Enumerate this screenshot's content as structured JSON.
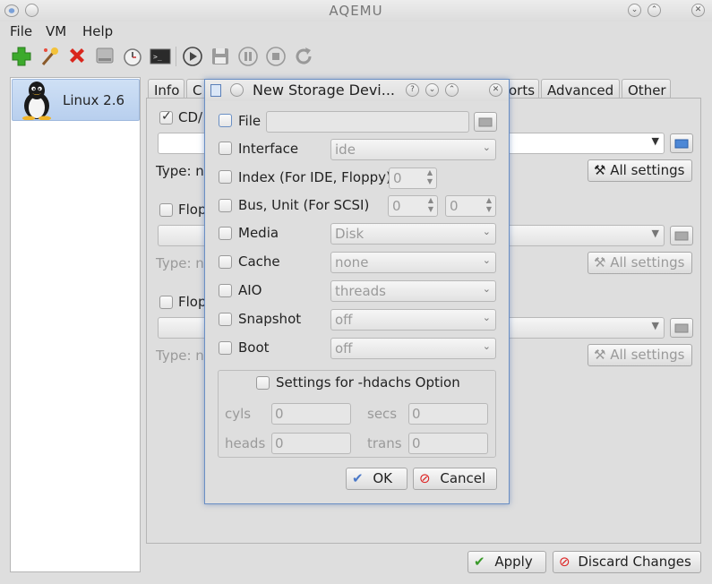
{
  "window": {
    "title": "AQEMU"
  },
  "menu": {
    "file": "File",
    "vm": "VM",
    "help": "Help"
  },
  "vm_list": [
    {
      "name": "Linux 2.6"
    }
  ],
  "tabs": {
    "info": "Info",
    "c": "C",
    "ports": "orts",
    "advanced": "Advanced",
    "other": "Other"
  },
  "background_panel": {
    "cdrom_label": "CD/",
    "floppy1_label": "Flop",
    "floppy2_label": "Flop",
    "type_label": "Type: n",
    "all_settings": "All settings"
  },
  "dialog": {
    "title": "New Storage Devi...",
    "rows": {
      "file": {
        "label": "File",
        "value": ""
      },
      "interface": {
        "label": "Interface",
        "value": "ide"
      },
      "index": {
        "label": "Index (For IDE, Floppy)",
        "value": "0"
      },
      "bus_unit": {
        "label": "Bus, Unit (For SCSI)",
        "bus": "0",
        "unit": "0"
      },
      "media": {
        "label": "Media",
        "value": "Disk"
      },
      "cache": {
        "label": "Cache",
        "value": "none"
      },
      "aio": {
        "label": "AIO",
        "value": "threads"
      },
      "snapshot": {
        "label": "Snapshot",
        "value": "off"
      },
      "boot": {
        "label": "Boot",
        "value": "off"
      }
    },
    "hdachs": {
      "label": "Settings for -hdachs Option",
      "cyls_label": "cyls",
      "cyls": "0",
      "secs_label": "secs",
      "secs": "0",
      "heads_label": "heads",
      "heads": "0",
      "trans_label": "trans",
      "trans": "0"
    },
    "ok": "OK",
    "cancel": "Cancel"
  },
  "footer": {
    "apply": "Apply",
    "discard": "Discard Changes"
  }
}
